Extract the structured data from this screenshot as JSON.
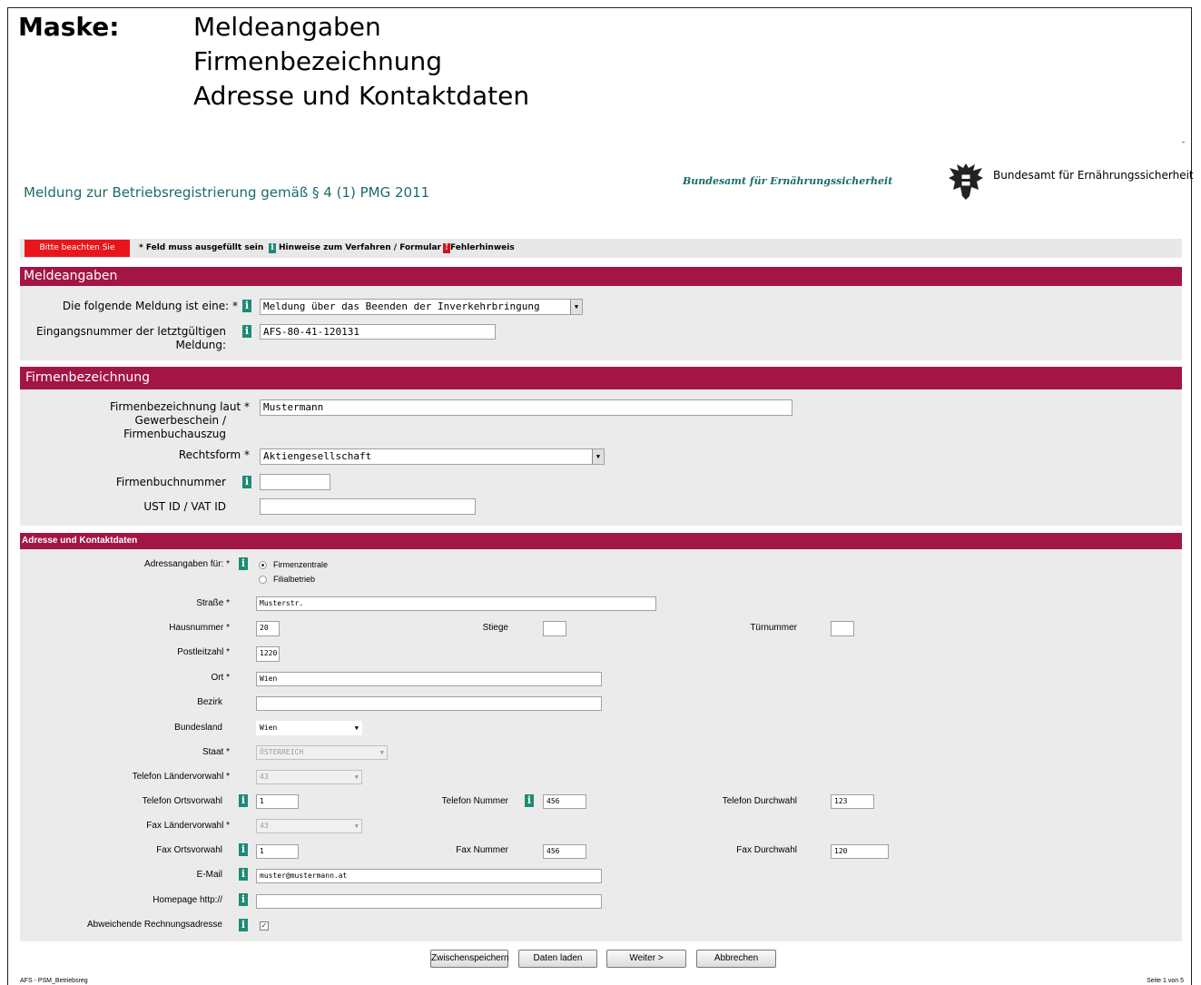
{
  "header": {
    "mask_label": "Maske:",
    "mask_lines": [
      "Meldeangaben",
      "Firmenbezeichnung",
      "Adresse und Kontaktdaten"
    ],
    "dash": "-"
  },
  "form": {
    "title": "Meldung zur Betriebsregistrierung gemäß § 4 (1) PMG 2011",
    "agency_italic": "Bundesamt für Ernährungssicherheit",
    "agency_right": "Bundesamt für Ernährungssicherheit"
  },
  "legend": {
    "notice": "Bitte beachten Sie",
    "required": "* Feld muss ausgefüllt sein",
    "info_icon": "i",
    "info_text": "Hinweise zum Verfahren / Formular",
    "error_icon": "!",
    "error_text": "Fehlerhinweis"
  },
  "icons": {
    "info": "info-icon",
    "error": "error-icon",
    "eagle": "austrian-eagle-emblem"
  },
  "colors": {
    "section_header": "#a31545",
    "info_icon": "#1e8a76",
    "notice": "#e8161b",
    "title": "#1d6b6b"
  },
  "sections": {
    "meldeangaben": {
      "title": "Meldeangaben",
      "meldung_label": "Die folgende Meldung ist eine: *",
      "meldung_value": "Meldung über das Beenden der Inverkehrbringung",
      "eingang_label_1": "Eingangsnummer der letztgültigen",
      "eingang_label_2": "Meldung:",
      "eingang_value": "AFS-80-41-120131"
    },
    "firma": {
      "title": "Firmenbezeichnung",
      "name_label_1": "Firmenbezeichnung laut *",
      "name_label_2": "Gewerbeschein /",
      "name_label_3": "Firmenbuchauszug",
      "name_value": "Mustermann",
      "rechtsform_label": "Rechtsform *",
      "rechtsform_value": "Aktiengesellschaft",
      "fbnr_label": "Firmenbuchnummer",
      "fbnr_value": "",
      "ust_label": "UST ID / VAT ID",
      "ust_value": ""
    },
    "adresse": {
      "title": "Adresse und Kontaktdaten",
      "adressangaben_label": "Adressangaben für: *",
      "radio_zentrale": "Firmenzentrale",
      "radio_filiale": "Filialbetrieb",
      "selected_radio": "Firmenzentrale",
      "strasse_label": "Straße *",
      "strasse_value": "Musterstr.",
      "hausnummer_label": "Hausnummer *",
      "hausnummer_value": "20",
      "stiege_label": "Stiege",
      "stiege_value": "",
      "tuer_label": "Türnummer",
      "tuer_value": "",
      "plz_label": "Postleitzahl *",
      "plz_value": "1220",
      "ort_label": "Ort *",
      "ort_value": "Wien",
      "bezirk_label": "Bezirk",
      "bezirk_value": "",
      "bundesland_label": "Bundesland",
      "bundesland_value": "Wien",
      "staat_label": "Staat *",
      "staat_value": "ÖSTERREICH",
      "tel_laender_label": "Telefon Ländervorwahl *",
      "tel_laender_value": "43",
      "tel_orts_label": "Telefon Ortsvorwahl",
      "tel_orts_value": "1",
      "tel_nummer_label": "Telefon Nummer",
      "tel_nummer_value": "456",
      "tel_durchwahl_label": "Telefon Durchwahl",
      "tel_durchwahl_value": "123",
      "fax_laender_label": "Fax Ländervorwahl *",
      "fax_laender_value": "43",
      "fax_orts_label": "Fax Ortsvorwahl",
      "fax_orts_value": "1",
      "fax_nummer_label": "Fax Nummer",
      "fax_nummer_value": "456",
      "fax_durchwahl_label": "Fax Durchwahl",
      "fax_durchwahl_value": "120",
      "email_label": "E-Mail",
      "email_value": "muster@mustermann.at",
      "homepage_label": "Homepage http://",
      "homepage_value": "",
      "rechnung_label": "Abweichende Rechnungsadresse",
      "rechnung_checked": "✓"
    }
  },
  "buttons": {
    "zwischenspeichern": "Zwischenspeichern",
    "daten_laden": "Daten laden",
    "weiter": "Weiter >",
    "abbrechen": "Abbrechen"
  },
  "footer": {
    "left": "AFS - PSM_Betriebsreg",
    "right": "Seite 1 von 5"
  }
}
